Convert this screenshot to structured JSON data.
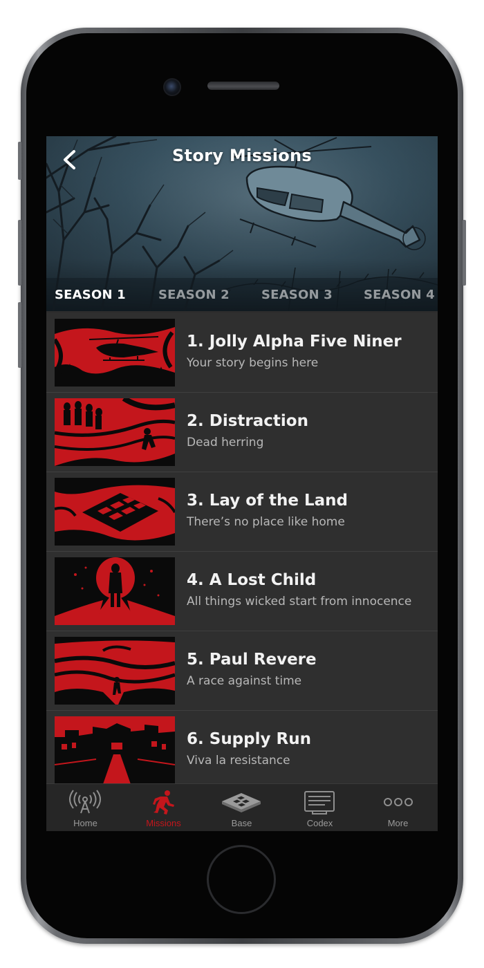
{
  "colors": {
    "accent": "#c4161c",
    "background": "#2d2d2d",
    "row_divider": "#3f3f3f",
    "tabbar": "#262626"
  },
  "header": {
    "title": "Story Missions",
    "back_icon": "chevron-left-icon"
  },
  "seasons": [
    {
      "label": "SEASON 1",
      "active": true
    },
    {
      "label": "SEASON 2",
      "active": false
    },
    {
      "label": "SEASON 3",
      "active": false
    },
    {
      "label": "SEASON 4",
      "active": false
    }
  ],
  "missions": [
    {
      "title": "1. Jolly Alpha Five Niner",
      "subtitle": "Your story begins here",
      "art": "helicopter"
    },
    {
      "title": "2. Distraction",
      "subtitle": "Dead herring",
      "art": "runners"
    },
    {
      "title": "3. Lay of the Land",
      "subtitle": "There’s no place like home",
      "art": "compound"
    },
    {
      "title": "4. A Lost Child",
      "subtitle": "All things wicked start from innocence",
      "art": "girl"
    },
    {
      "title": "5. Paul Revere",
      "subtitle": "A race against time",
      "art": "runner-hills"
    },
    {
      "title": "6. Supply Run",
      "subtitle": "Viva la resistance",
      "art": "town"
    }
  ],
  "tabbar": [
    {
      "label": "Home",
      "icon": "radio-tower-icon",
      "active": false
    },
    {
      "label": "Missions",
      "icon": "running-man-icon",
      "active": true
    },
    {
      "label": "Base",
      "icon": "base-tile-icon",
      "active": false
    },
    {
      "label": "Codex",
      "icon": "codex-screen-icon",
      "active": false
    },
    {
      "label": "More",
      "icon": "more-dots-icon",
      "active": false
    }
  ]
}
